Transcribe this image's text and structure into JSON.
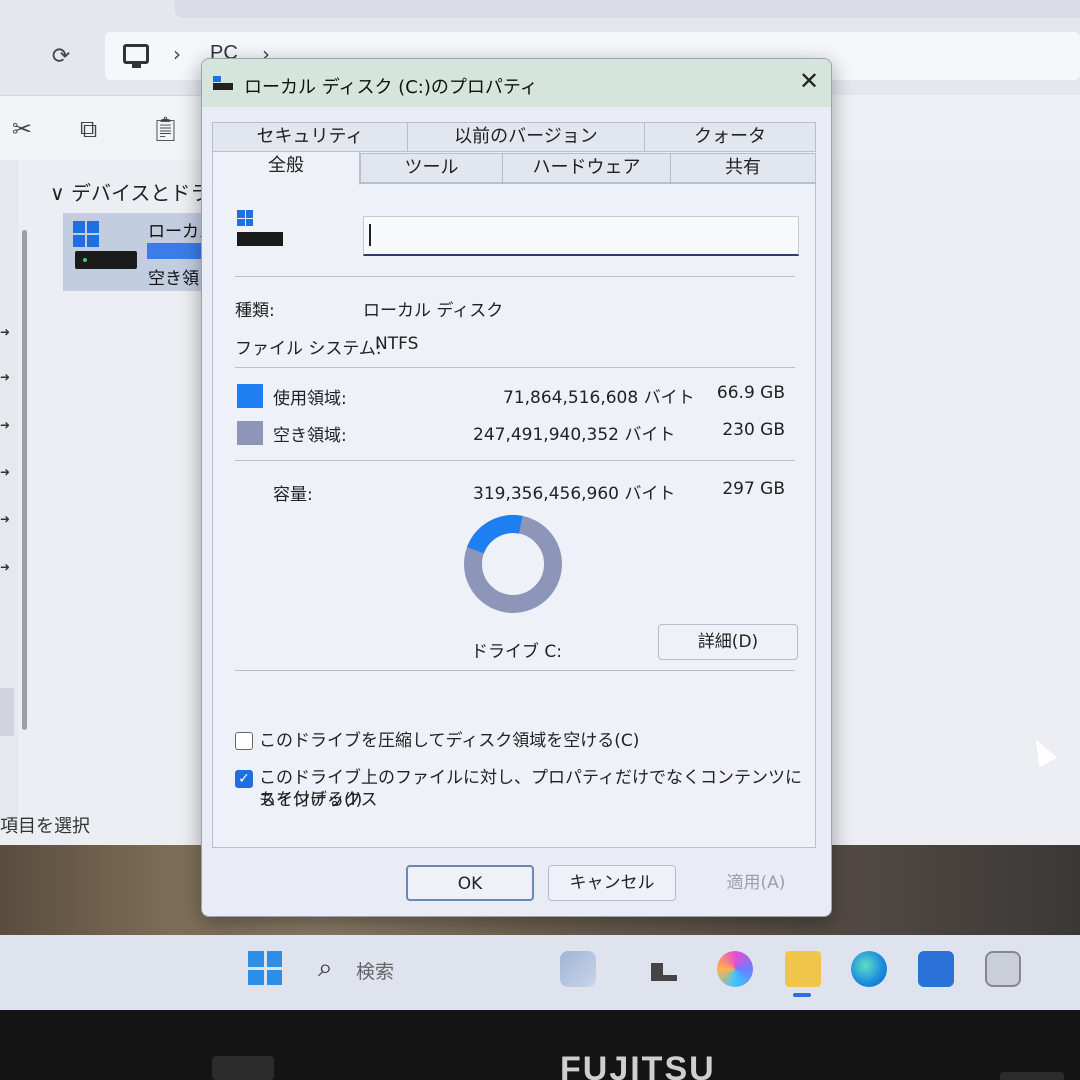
{
  "explorer": {
    "breadcrumb": "PC",
    "group_header": "デバイスとドライ",
    "drive_name": "ローカル",
    "drive_free": "空き領",
    "status": "項目を選択"
  },
  "dialog": {
    "title": "ローカル ディスク (C:)のプロパティ",
    "close": "✕",
    "tabs_back": [
      "セキュリティ",
      "以前のバージョン",
      "クォータ"
    ],
    "tabs_front": [
      "全般",
      "ツール",
      "ハードウェア",
      "共有"
    ],
    "active_tab": "全般",
    "volume_label": "",
    "type_label": "種類:",
    "type_value": "ローカル ディスク",
    "fs_label": "ファイル システム:",
    "fs_value": "NTFS",
    "used_label": "使用領域:",
    "used_bytes": "71,864,516,608 バイト",
    "used_size": "66.9 GB",
    "free_label": "空き領域:",
    "free_bytes": "247,491,940,352 バイト",
    "free_size": "230 GB",
    "cap_label": "容量:",
    "cap_bytes": "319,356,456,960 バイト",
    "cap_size": "297 GB",
    "used_fraction": 0.225,
    "used_color": "#1e80f0",
    "free_color": "#8d96b8",
    "drive_caption": "ドライブ C:",
    "details_button": "詳細(D)",
    "compress_label": "このドライブを圧縮してディスク領域を空ける(C)",
    "compress_checked": false,
    "index_label_1": "このドライブ上のファイルに対し、プロパティだけでなくコンテンツにもインデックス",
    "index_label_2": "スを付ける(I)",
    "index_checked": true,
    "ok": "OK",
    "cancel": "キャンセル",
    "apply": "適用(A)"
  },
  "taskbar": {
    "search_placeholder": "検索"
  },
  "bezel": {
    "brand": "FUJITSU"
  }
}
